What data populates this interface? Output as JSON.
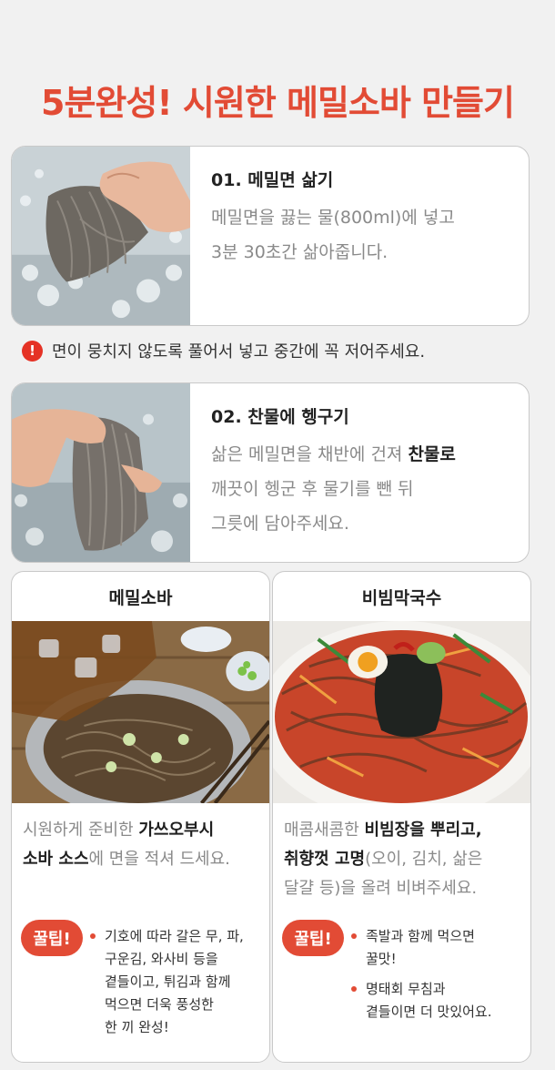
{
  "header": {
    "title": "5분완성! 시원한 메밀소바 만들기"
  },
  "steps": [
    {
      "title": "01. 메밀면 삶기",
      "line1": "메밀면을 끓는 물(800ml)에 넣고",
      "line2": "3분 30초간 삶아줍니다."
    },
    {
      "title": "02. 찬물에 헹구기",
      "line1_pre": "삶은 메밀면을 채반에 건져 ",
      "line1_bold": "찬물로",
      "line2": "깨끗이 헹군 후 물기를 뺀 뒤",
      "line3": "그릇에 담아주세요."
    }
  ],
  "notice": {
    "icon": "!",
    "text": "면이 뭉치지 않도록 풀어서 넣고 중간에 꼭 저어주세요."
  },
  "recipes": [
    {
      "name": "메밀소바",
      "desc_l1_pre": "시원하게 준비한 ",
      "desc_l1_bold": "가쓰오부시",
      "desc_l2_bold": "소바 소스",
      "desc_l2_post": "에 면을 적셔 드세요.",
      "tip_label": "꿀팁!",
      "tips": [
        "기호에 따라 갈은 무, 파,\n구운김, 와사비 등을\n곁들이고, 튀김과 함께\n먹으면 더욱 풍성한\n한 끼 완성!"
      ]
    },
    {
      "name": "비빔막국수",
      "desc_l1_pre": "매콤새콤한 ",
      "desc_l1_bold": "비빔장을 뿌리고,",
      "desc_l2_bold": "취향껏 고명",
      "desc_l2_post": "(오이, 김치, 삶은",
      "desc_l3": "달걀 등)을 올려 비벼주세요.",
      "tip_label": "꿀팁!",
      "tips": [
        "족발과 함께 먹으면\n꿀맛!",
        "명태회 무침과\n곁들이면 더 맛있어요."
      ]
    }
  ],
  "colors": {
    "accent": "#e24b35",
    "alert": "#e53225"
  }
}
